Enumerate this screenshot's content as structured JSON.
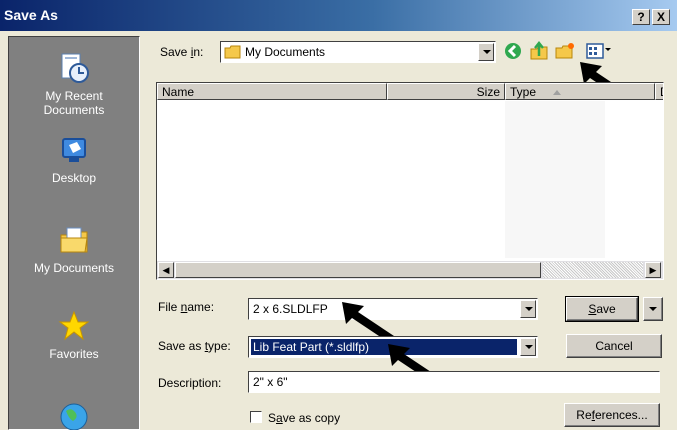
{
  "window": {
    "title": "Save As",
    "help_btn": "?",
    "close_btn": "X"
  },
  "places": [
    {
      "label": "My Recent Documents",
      "icon": "recent-documents-icon"
    },
    {
      "label": "Desktop",
      "icon": "desktop-icon"
    },
    {
      "label": "My Documents",
      "icon": "my-documents-icon"
    },
    {
      "label": "Favorites",
      "icon": "favorites-icon"
    },
    {
      "label": "",
      "icon": "network-globe-icon"
    }
  ],
  "save_in": {
    "label_pre": "Save ",
    "label_key": "i",
    "label_post": "n:",
    "value": "My Documents"
  },
  "toolbar": [
    "back-icon",
    "up-folder-icon",
    "new-folder-icon",
    "views-menu-icon"
  ],
  "list": {
    "columns": {
      "name": "Name",
      "size": "Size",
      "type": "Type",
      "date": "D"
    }
  },
  "file_name": {
    "label_pre": "File ",
    "label_key": "n",
    "label_post": "ame:",
    "value": "2 x 6.SLDLFP"
  },
  "save_type": {
    "label_pre": "Save as ",
    "label_key": "t",
    "label_post": "ype:",
    "value": "Lib Feat Part (*.sldlfp)"
  },
  "description": {
    "label": "Description:",
    "value": "2\" x 6\""
  },
  "save_copy": {
    "pre": "S",
    "key": "a",
    "post": "ve as copy",
    "checked": false
  },
  "buttons": {
    "save": {
      "key": "S",
      "rest": "ave"
    },
    "cancel": "Cancel",
    "references": {
      "pre": "Re",
      "key": "f",
      "post": "erences..."
    }
  },
  "colors": {
    "titlebar_start": "#0a246a",
    "selection": "#0a246a",
    "places_bg": "#808080",
    "annotation_arrow": "#000000"
  }
}
